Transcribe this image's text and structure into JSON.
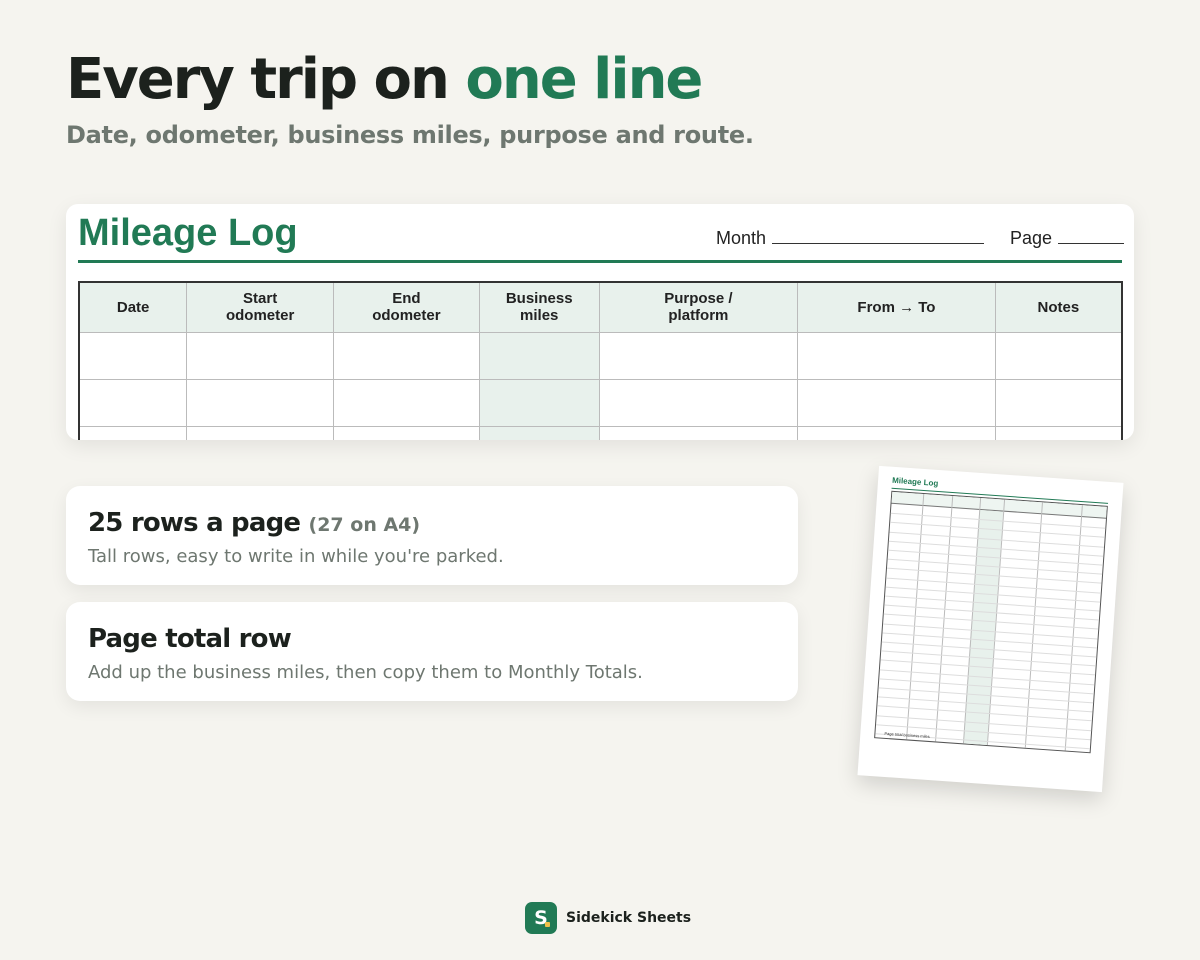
{
  "header": {
    "title_main": "Every trip on ",
    "title_accent": "one line",
    "subtitle": "Date, odometer, business miles, purpose and route."
  },
  "log": {
    "title": "Mileage Log",
    "month_label": "Month",
    "page_label": "Page",
    "columns": [
      "Date",
      "Start\nodometer",
      "End\nodometer",
      "Business\nmiles",
      "Purpose /\nplatform",
      "From → To",
      "Notes"
    ]
  },
  "features": [
    {
      "title": "25 rows a page",
      "title_note": "(27 on A4)",
      "description": "Tall rows, easy to write in while you're parked."
    },
    {
      "title": "Page total row",
      "title_note": "",
      "description": "Add up the business miles, then copy them to Monthly Totals."
    }
  ],
  "thumbnail": {
    "title": "Mileage Log",
    "footer": "Page total business miles"
  },
  "brand": {
    "logo_letter": "S",
    "name": "Sidekick Sheets",
    "color": "#217a55"
  }
}
